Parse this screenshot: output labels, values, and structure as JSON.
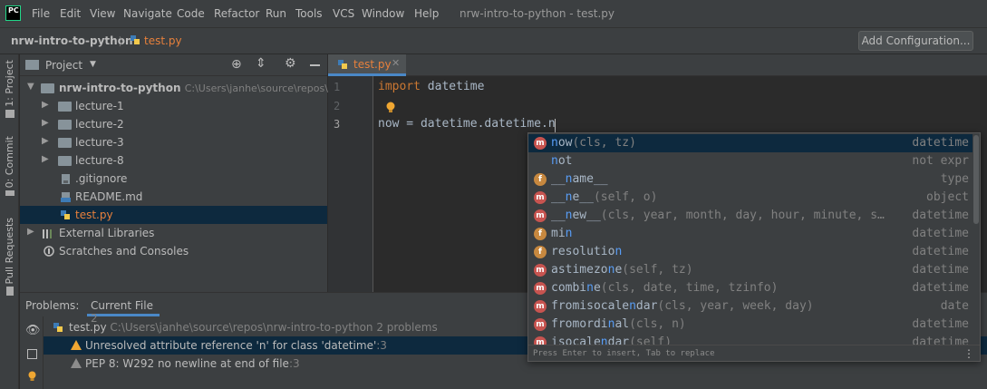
{
  "app": {
    "logo": "PC",
    "window_title": "nrw-intro-to-python - test.py"
  },
  "menu": [
    "File",
    "Edit",
    "View",
    "Navigate",
    "Code",
    "Refactor",
    "Run",
    "Tools",
    "VCS",
    "Window",
    "Help"
  ],
  "navbar": {
    "project": "nrw-intro-to-python",
    "file": "test.py",
    "add_config": "Add Configuration..."
  },
  "left_strip": {
    "project_tab": "1: Project",
    "commit_tab": "0: Commit",
    "pull_requests_tab": "Pull Requests"
  },
  "project_panel": {
    "title": "Project",
    "tree": [
      {
        "label": "nrw-intro-to-python",
        "hint": "C:\\Users\\janhe\\source\\repos\\nrw",
        "kind": "folder"
      },
      {
        "label": "lecture-1",
        "kind": "folder"
      },
      {
        "label": "lecture-2",
        "kind": "folder"
      },
      {
        "label": "lecture-3",
        "kind": "folder"
      },
      {
        "label": "lecture-8",
        "kind": "folder"
      },
      {
        "label": ".gitignore",
        "kind": "file"
      },
      {
        "label": "README.md",
        "kind": "file"
      },
      {
        "label": "test.py",
        "kind": "file"
      },
      {
        "label": "External Libraries",
        "kind": "library"
      },
      {
        "label": "Scratches and Consoles",
        "kind": "scratch"
      }
    ]
  },
  "editor": {
    "tab_label": "test.py",
    "lines": [
      {
        "no": "1",
        "kw": "import",
        "rest": " datetime"
      },
      {
        "no": "2",
        "kw": "",
        "rest": ""
      },
      {
        "no": "3",
        "kw": "",
        "rest": "now = datetime.datetime.n"
      }
    ]
  },
  "completion": {
    "items": [
      {
        "badge": "m",
        "pre": "",
        "match": "n",
        "post": "ow",
        "sig": "(cls, tz)",
        "type": "datetime"
      },
      {
        "badge": "",
        "pre": "",
        "match": "n",
        "post": "ot",
        "sig": "",
        "type": "not expr"
      },
      {
        "badge": "f",
        "pre": "__",
        "match": "n",
        "post": "ame__",
        "sig": "",
        "type": "type"
      },
      {
        "badge": "m",
        "pre": "__",
        "match": "n",
        "post": "e__",
        "sig": "(self, o)",
        "type": "object"
      },
      {
        "badge": "m",
        "pre": "__",
        "match": "n",
        "post": "ew__",
        "sig": "(cls, year, month, day, hour, minute, s…",
        "type": "datetime"
      },
      {
        "badge": "f",
        "pre": "mi",
        "match": "n",
        "post": "",
        "sig": "",
        "type": "datetime"
      },
      {
        "badge": "f",
        "pre": "resolutio",
        "match": "n",
        "post": "",
        "sig": "",
        "type": "datetime"
      },
      {
        "badge": "m",
        "pre": "astimezo",
        "match": "n",
        "post": "e",
        "sig": "(self, tz)",
        "type": "datetime"
      },
      {
        "badge": "m",
        "pre": "combi",
        "match": "n",
        "post": "e",
        "sig": "(cls, date, time, tzinfo)",
        "type": "datetime"
      },
      {
        "badge": "m",
        "pre": "fromisocale",
        "match": "n",
        "post": "dar",
        "sig": "(cls, year, week, day)",
        "type": "date"
      },
      {
        "badge": "m",
        "pre": "fromordi",
        "match": "n",
        "post": "al",
        "sig": "(cls, n)",
        "type": "datetime"
      },
      {
        "badge": "m",
        "pre": "isocale",
        "match": "n",
        "post": "dar",
        "sig": "(self)",
        "type": "datetime"
      }
    ],
    "footer_hint": "Press Enter to insert, Tab to replace",
    "more_icon": "⋮"
  },
  "problems": {
    "label": "Problems:",
    "tab": "Current File",
    "count": "2",
    "file": "test.py",
    "file_path": "C:\\Users\\janhe\\source\\repos\\nrw-intro-to-python",
    "file_summary": "2 problems",
    "items": [
      {
        "text": "Unresolved attribute reference 'n' for class 'datetime'",
        "loc": ":3"
      },
      {
        "text": "PEP 8: W292 no newline at end of file",
        "loc": ":3"
      }
    ]
  },
  "colors": {
    "accent": "#4a88c7",
    "selection": "#0d293e",
    "warning": "#f0a732",
    "file_modified": "#e7803c"
  }
}
